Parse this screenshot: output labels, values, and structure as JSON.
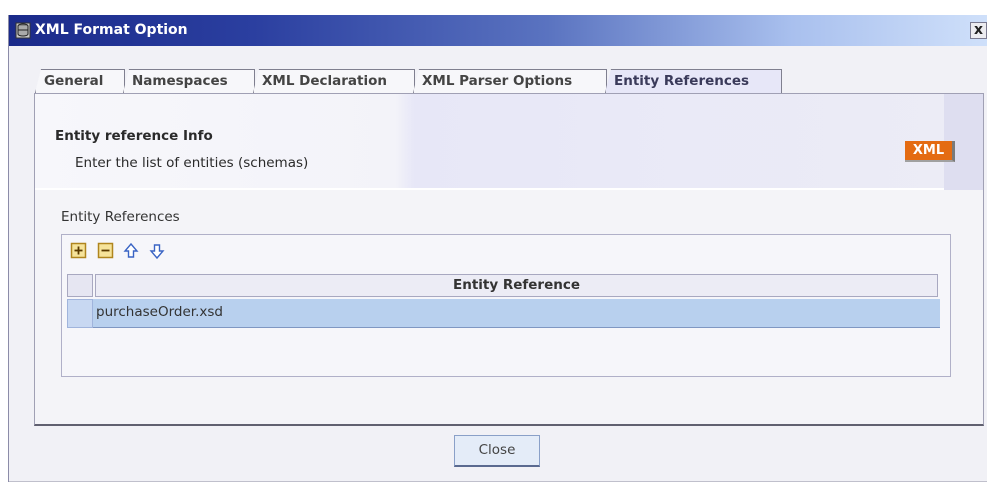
{
  "window": {
    "title": "XML Format Option",
    "title_icon": "db-icon",
    "close_glyph": "x"
  },
  "tabs": [
    {
      "label": "General",
      "active": false
    },
    {
      "label": "Namespaces",
      "active": false
    },
    {
      "label": "XML Declaration",
      "active": false
    },
    {
      "label": "XML Parser Options",
      "active": false
    },
    {
      "label": "Entity References",
      "active": true
    }
  ],
  "info": {
    "title": "Entity reference Info",
    "description": "Enter the list of entities (schemas)",
    "badge": "XML",
    "badge_color": "#e46b12"
  },
  "entity_references": {
    "section_label": "Entity References",
    "toolbar": [
      {
        "name": "add-icon",
        "glyph": "+"
      },
      {
        "name": "remove-icon",
        "glyph": "−"
      },
      {
        "name": "move-up-icon",
        "glyph": "up-arrow"
      },
      {
        "name": "move-down-icon",
        "glyph": "down-arrow"
      }
    ],
    "column_header": "Entity Reference",
    "rows": [
      {
        "value": "purchaseOrder.xsd",
        "selected": true
      }
    ]
  },
  "footer": {
    "close_label": "Close"
  },
  "colors": {
    "title_bar_start": "#1a2a8a",
    "title_bar_end": "#cfe0fa",
    "selection": "#b8d0ee"
  }
}
